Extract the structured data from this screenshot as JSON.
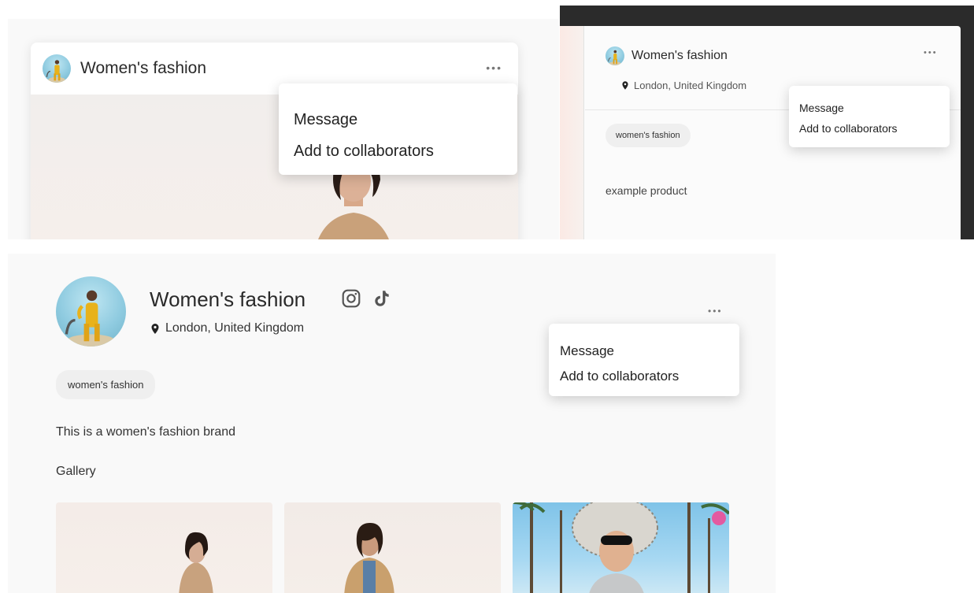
{
  "brand": {
    "name": "Women's fashion",
    "location": "London, United Kingdom",
    "tag": "women's fashion"
  },
  "menu": {
    "message": "Message",
    "add_collaborators": "Add to collaborators"
  },
  "more_button": "•••",
  "panel_b": {
    "description": "example product"
  },
  "panel_c": {
    "description": "This is a women's fashion brand",
    "gallery_label": "Gallery",
    "social": [
      "instagram-icon",
      "tiktok-icon"
    ],
    "gallery_items": [
      "gallery-photo-beige-sweater",
      "gallery-photo-puffer-jacket",
      "gallery-photo-sun-hat"
    ]
  },
  "colors": {
    "background": "#f9f9f9",
    "dark_frame": "#2b2b2b",
    "tag_bg": "#efefef",
    "menu_bg": "#ffffff"
  }
}
